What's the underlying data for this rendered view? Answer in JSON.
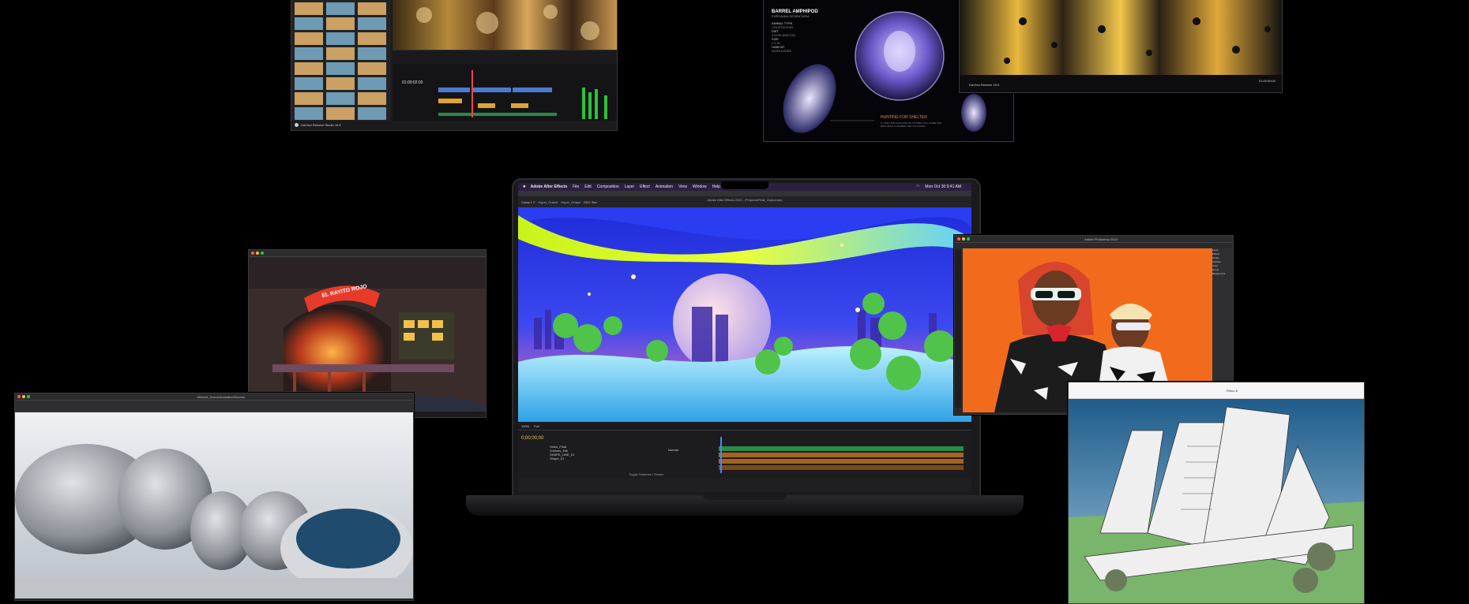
{
  "resolve_window": {
    "app_label": "DaVinci Resolve Studio 18.5",
    "timecode": "01:00:02:03"
  },
  "specimen_window": {
    "heading": "BARREL AMPHIPOD",
    "subheading": "PHRONIMA SEDENTARIA",
    "details": [
      "ANIMAL TYPE",
      "CRUSTACEAN",
      "DIET",
      "ZOOPLANKTON",
      "SIZE",
      "2.5 IN",
      "HABITAT",
      "WORLDWIDE"
    ],
    "caption": "HUNTING FOR SHELTER",
    "caption_body": "IT USES THE CARCASS OF ITS PREY AS A HOME AND BROODING CHAMBER FOR ITS YOUNG."
  },
  "resolve_window_2": {
    "app_label": "DaVinci Resolve 18.5",
    "timecode": "01:00:00:00"
  },
  "laptop": {
    "menu": [
      "Adobe After Effects",
      "File",
      "Edit",
      "Composition",
      "Layer",
      "Effect",
      "Animation",
      "View",
      "Window",
      "Help"
    ],
    "clock": "Mon Oct 30  9:41 AM",
    "window_title": "Adobe After Effects 2023 - /Projects/Final_Output.aep",
    "comp_tabs": [
      "Comp 1 ≡",
      "Hyper_Output",
      "Hyper_Output",
      "DEC Sec"
    ],
    "timecode": "0;00;00;00",
    "zoom": "100%",
    "quality": "Full",
    "layers": [
      "Video_Final",
      "Vortices_16k",
      "SHAPE_LINE_01",
      "Shape_01"
    ],
    "mode": "Normal",
    "footer": "Toggle Switches / Modes"
  },
  "rojo_window": {
    "sign": "EL RAYITO ROJO"
  },
  "photoshop_window": {
    "title": "Adobe Photoshop 2024",
    "layers": [
      "Layer",
      "Effects",
      "Stroke",
      "Shadow",
      "Color",
      "Group",
      "Background"
    ]
  },
  "stones_window": {
    "path": "Mitchell_Scene/Animation/Scenes"
  },
  "arch_window": {
    "title": "Rhino 8"
  },
  "colors": {
    "bg": "#000000",
    "accent": "#ff4d1f",
    "orange_bg": "#f26b1d",
    "timeline_green": "#2a8a4a"
  }
}
